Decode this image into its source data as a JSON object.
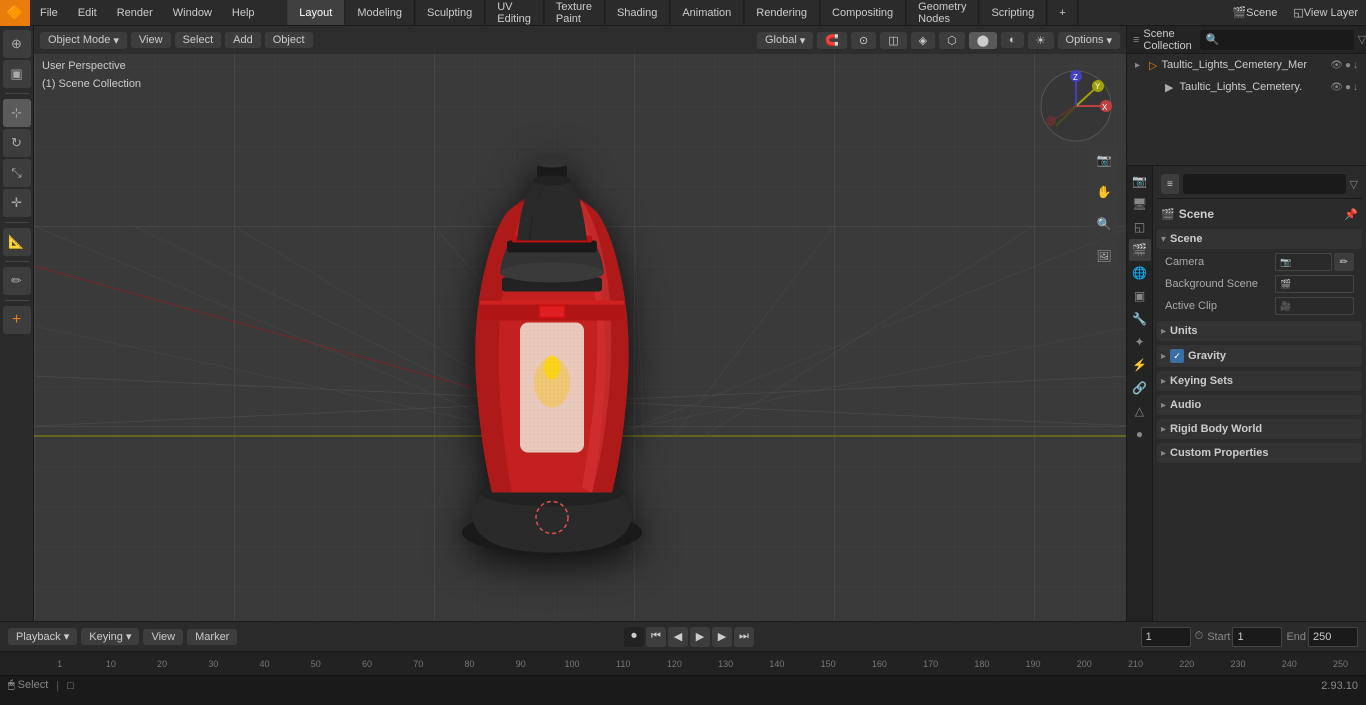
{
  "app": {
    "title": "Blender",
    "version": "2.93.10"
  },
  "top_menu": {
    "logo": "B",
    "items": [
      "File",
      "Edit",
      "Render",
      "Window",
      "Help"
    ],
    "tabs": [
      "Layout",
      "Modeling",
      "Sculpting",
      "UV Editing",
      "Texture Paint",
      "Shading",
      "Animation",
      "Rendering",
      "Compositing",
      "Geometry Nodes",
      "Scripting"
    ],
    "active_tab": "Layout",
    "add_tab_label": "+",
    "right_items": [
      "Scene",
      "View Layer"
    ]
  },
  "header_toolbar": {
    "object_mode": "Object Mode",
    "view": "View",
    "select": "Select",
    "add": "Add",
    "object": "Object",
    "global": "Global",
    "options": "Options"
  },
  "viewport": {
    "view_label": "User Perspective",
    "collection_label": "(1) Scene Collection",
    "grid_color": "#404040",
    "bg_color": "#3a3a3a"
  },
  "left_toolbar": {
    "tools": [
      {
        "name": "cursor-tool",
        "icon": "⊕",
        "active": false
      },
      {
        "name": "select-tool",
        "icon": "▣",
        "active": false
      },
      {
        "name": "move-tool",
        "icon": "⊹",
        "active": true
      },
      {
        "name": "rotate-tool",
        "icon": "↻",
        "active": false
      },
      {
        "name": "scale-tool",
        "icon": "⤡",
        "active": false
      },
      {
        "name": "transform-tool",
        "icon": "✛",
        "active": false
      },
      {
        "name": "measure-tool",
        "icon": "📏",
        "active": false
      },
      {
        "name": "annotate-tool",
        "icon": "✏",
        "active": false
      },
      {
        "name": "add-tool",
        "icon": "+",
        "active": false
      }
    ]
  },
  "outliner": {
    "title": "Scene Collection",
    "search_placeholder": "🔍",
    "items": [
      {
        "name": "Taultic_Lights_Cemetery_Mer",
        "icon": "▸",
        "depth": 1,
        "actions": [
          "👁",
          "●",
          "↓"
        ]
      },
      {
        "name": "Taultic_Lights_Cemetery.",
        "icon": "⬛",
        "depth": 2,
        "actions": [
          "👁",
          "●",
          "↓"
        ]
      }
    ]
  },
  "properties": {
    "header": "Scene",
    "search_placeholder": "",
    "sections": [
      {
        "name": "Scene",
        "expanded": true,
        "fields": [
          {
            "label": "Camera",
            "type": "field",
            "value": ""
          },
          {
            "label": "Background Scene",
            "type": "field",
            "value": ""
          },
          {
            "label": "Active Clip",
            "type": "field",
            "value": ""
          }
        ]
      },
      {
        "name": "Units",
        "expanded": false
      },
      {
        "name": "Gravity",
        "expanded": false,
        "checkbox": true
      },
      {
        "name": "Keying Sets",
        "expanded": false
      },
      {
        "name": "Audio",
        "expanded": false
      },
      {
        "name": "Rigid Body World",
        "expanded": false
      },
      {
        "name": "Custom Properties",
        "expanded": false
      }
    ]
  },
  "props_sidebar_icons": [
    {
      "name": "render-icon",
      "icon": "📷",
      "active": false
    },
    {
      "name": "output-icon",
      "icon": "🖥",
      "active": false
    },
    {
      "name": "view-layer-icon",
      "icon": "◱",
      "active": false
    },
    {
      "name": "scene-icon",
      "icon": "🎬",
      "active": true
    },
    {
      "name": "world-icon",
      "icon": "🌐",
      "active": false
    },
    {
      "name": "object-icon",
      "icon": "▣",
      "active": false
    },
    {
      "name": "modifier-icon",
      "icon": "🔧",
      "active": false
    },
    {
      "name": "particles-icon",
      "icon": "⁂",
      "active": false
    },
    {
      "name": "physics-icon",
      "icon": "⚡",
      "active": false
    },
    {
      "name": "constraints-icon",
      "icon": "🔗",
      "active": false
    },
    {
      "name": "object-data-icon",
      "icon": "△",
      "active": false
    },
    {
      "name": "material-icon",
      "icon": "●",
      "active": false
    }
  ],
  "timeline": {
    "playback_label": "Playback",
    "keying_label": "Keying",
    "view_label": "View",
    "marker_label": "Marker",
    "frame_current": "1",
    "start_label": "Start",
    "start_value": "1",
    "end_label": "End",
    "end_value": "250",
    "controls": [
      "⏮",
      "⏮",
      "◀",
      "▶",
      "⏭",
      "⏭"
    ]
  },
  "frame_ruler": {
    "ticks": [
      "1",
      "10",
      "20",
      "30",
      "40",
      "50",
      "60",
      "70",
      "80",
      "90",
      "100",
      "110",
      "120",
      "130",
      "140",
      "150",
      "160",
      "170",
      "180",
      "190",
      "200",
      "210",
      "220",
      "230",
      "240",
      "250"
    ]
  },
  "status_bar": {
    "select_label": "Select",
    "version": "2.93.10",
    "info_icon": "ℹ"
  }
}
